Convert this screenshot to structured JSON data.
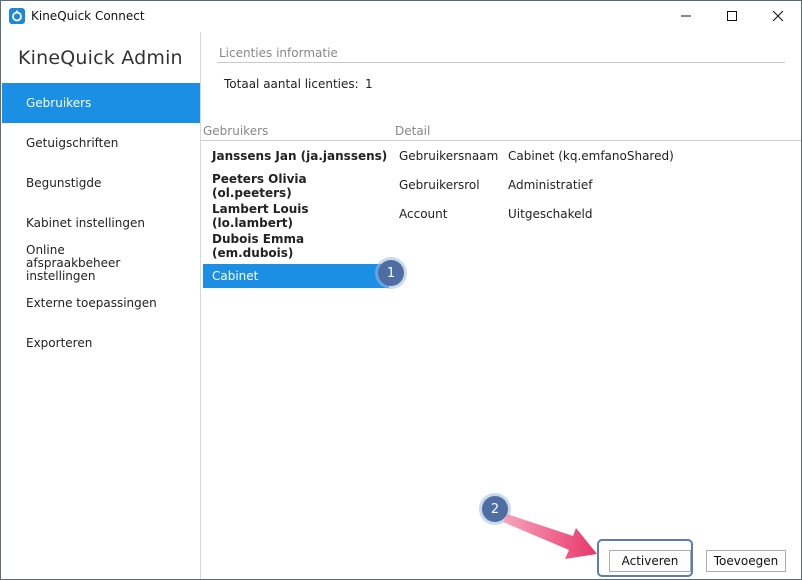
{
  "window": {
    "title": "KineQuick Connect"
  },
  "sidebar": {
    "title": "KineQuick Admin",
    "items": [
      {
        "label": "Gebruikers",
        "active": true
      },
      {
        "label": "Getuigschriften"
      },
      {
        "label": "Begunstigde"
      },
      {
        "label": "Kabinet instellingen"
      },
      {
        "label": "Online afspraakbeheer instellingen"
      },
      {
        "label": "Externe toepassingen"
      },
      {
        "label": "Exporteren"
      }
    ]
  },
  "licenses": {
    "section_label": "Licenties informatie",
    "total_label": "Totaal aantal licenties:",
    "total_value": "1"
  },
  "users": {
    "column_label": "Gebruikers",
    "items": [
      "Janssens Jan (ja.janssens)",
      "Peeters Olivia (ol.peeters)",
      "Lambert Louis (lo.lambert)",
      "Dubois Emma (em.dubois)",
      "Cabinet"
    ],
    "selected": "Cabinet"
  },
  "detail": {
    "column_label": "Detail",
    "rows": [
      {
        "key": "Gebruikersnaam",
        "value": "Cabinet (kq.emfanoShared)"
      },
      {
        "key": "Gebruikersrol",
        "value": "Administratief"
      },
      {
        "key": "Account",
        "value": "Uitgeschakeld"
      }
    ]
  },
  "annotations": {
    "step1": "1",
    "step2": "2"
  },
  "buttons": {
    "activate": "Activeren",
    "add": "Toevoegen"
  },
  "colors": {
    "accent": "#1a8fe3",
    "badge": "#4e6ea3",
    "arrow": "#e8356b"
  }
}
